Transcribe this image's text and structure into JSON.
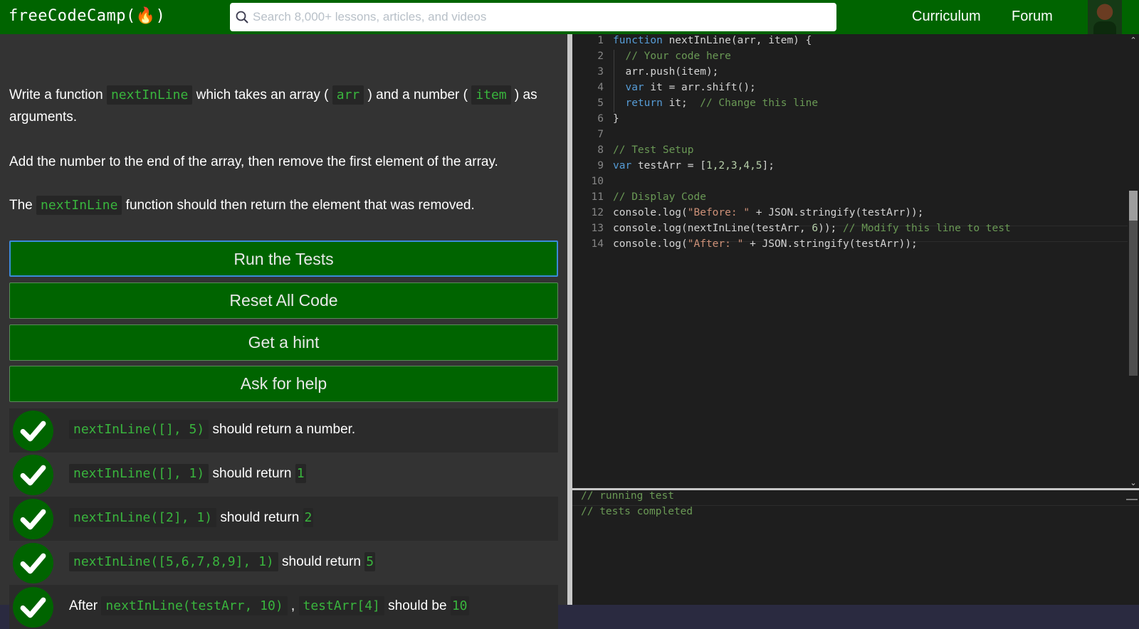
{
  "nav": {
    "logo": "freeCodeCamp(🔥)",
    "search_placeholder": "Search 8,000+ lessons, articles, and videos",
    "links": [
      "Curriculum",
      "Forum"
    ]
  },
  "description": {
    "p1_a": "Write a function ",
    "p1_code1": "nextInLine",
    "p1_b": " which takes an array ( ",
    "p1_code2": "arr",
    "p1_c": " ) and a number ( ",
    "p1_code3": "item",
    "p1_d": " ) as arguments.",
    "p2": "Add the number to the end of the array, then remove the first element of the array.",
    "p3_a": "The ",
    "p3_code": "nextInLine",
    "p3_b": " function should then return the element that was removed."
  },
  "buttons": {
    "run": "Run the Tests",
    "reset": "Reset All Code",
    "hint": "Get a hint",
    "help": "Ask for help"
  },
  "tests": [
    {
      "code": "nextInLine([], 5)",
      "text": " should return a number."
    },
    {
      "code": "nextInLine([], 1)",
      "text": " should return ",
      "code2": "1"
    },
    {
      "code": "nextInLine([2], 1)",
      "text": " should return ",
      "code2": "2"
    },
    {
      "code": "nextInLine([5,6,7,8,9], 1)",
      "text": " should return ",
      "code2": "5"
    },
    {
      "pre": "After ",
      "code": "nextInLine(testArr, 10)",
      "mid": " , ",
      "code3": "testArr[4]",
      "text": " should be ",
      "code2": "10"
    }
  ],
  "editor": {
    "line_numbers": [
      "1",
      "2",
      "3",
      "4",
      "5",
      "6",
      "7",
      "8",
      "9",
      "10",
      "11",
      "12",
      "13",
      "14"
    ],
    "l1_kw": "function",
    "l1_rest": " nextInLine(arr, item) {",
    "l2": "  // Your code here",
    "l3": "  arr.push(item);",
    "l4_kw": "  var",
    "l4_rest": " it = arr.shift();",
    "l5_kw": "  return",
    "l5_rest": " it;  ",
    "l5_cm": "// Change this line",
    "l6": "}",
    "l8": "// Test Setup",
    "l9_kw": "var",
    "l9_a": " testArr = [",
    "l9_nums": "1,2,3,4,5",
    "l9_b": "];",
    "l11": "// Display Code",
    "l12_a": "console.log(",
    "l12_st": "\"Before: \"",
    "l12_b": " + JSON.stringify(testArr));",
    "l13_a": "console.log(nextInLine(testArr, ",
    "l13_num": "6",
    "l13_b": ")); ",
    "l13_cm": "// Modify this line to test",
    "l14_a": "console.log(",
    "l14_st": "\"After: \"",
    "l14_b": " + JSON.stringify(testArr));"
  },
  "console": {
    "lines": [
      "// running test",
      "// tests completed"
    ]
  }
}
